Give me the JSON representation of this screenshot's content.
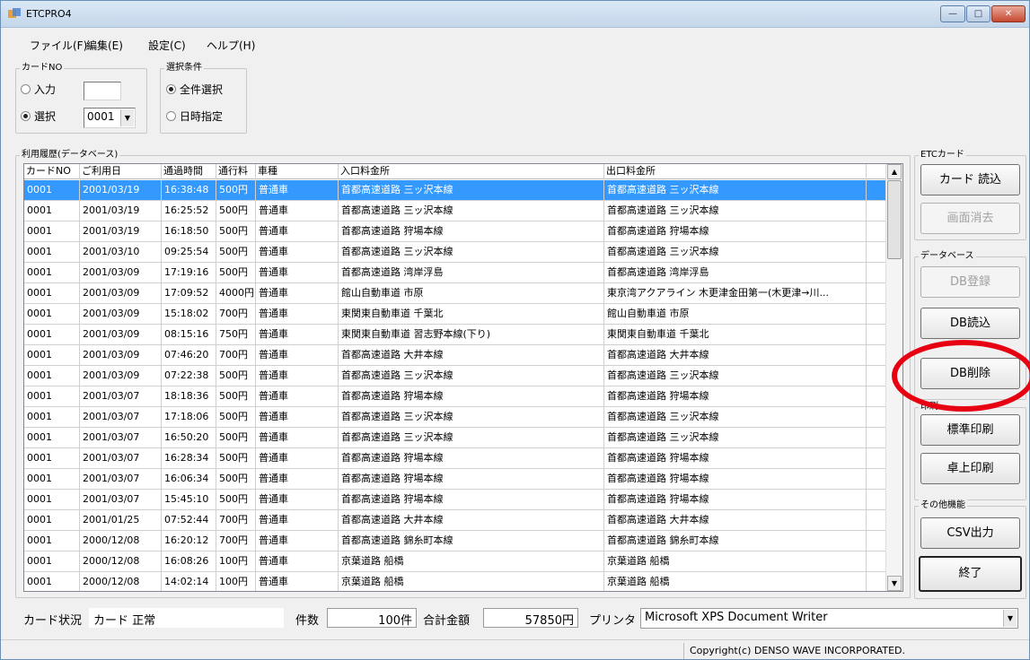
{
  "window": {
    "title": "ETCPRO4",
    "minimize": "—",
    "maximize": "□",
    "close": "✕"
  },
  "menu": [
    "ファイル(F)",
    "編集(E)",
    "設定(C)",
    "ヘルプ(H)"
  ],
  "card_no": {
    "legend": "カードNO",
    "input_label": "入力",
    "input_value": "",
    "select_label": "選択",
    "select_value": "0001",
    "selected": "選択"
  },
  "condition": {
    "legend": "選択条件",
    "all_label": "全件選択",
    "date_label": "日時指定",
    "selected": "全件選択"
  },
  "history": {
    "legend": "利用履歴(データベース)",
    "columns": [
      "カードNO",
      "ご利用日",
      "通過時間",
      "通行料金",
      "車種",
      "入口料金所",
      "出口料金所"
    ],
    "rows": [
      [
        "0001",
        "2001/03/19",
        "16:38:48",
        "500円",
        "普通車",
        "首都高速道路 三ッ沢本線",
        "首都高速道路 三ッ沢本線"
      ],
      [
        "0001",
        "2001/03/19",
        "16:25:52",
        "500円",
        "普通車",
        "首都高速道路 三ッ沢本線",
        "首都高速道路 三ッ沢本線"
      ],
      [
        "0001",
        "2001/03/19",
        "16:18:50",
        "500円",
        "普通車",
        "首都高速道路 狩場本線",
        "首都高速道路 狩場本線"
      ],
      [
        "0001",
        "2001/03/10",
        "09:25:54",
        "500円",
        "普通車",
        "首都高速道路 三ッ沢本線",
        "首都高速道路 三ッ沢本線"
      ],
      [
        "0001",
        "2001/03/09",
        "17:19:16",
        "500円",
        "普通車",
        "首都高速道路 湾岸浮島",
        "首都高速道路 湾岸浮島"
      ],
      [
        "0001",
        "2001/03/09",
        "17:09:52",
        "4000円",
        "普通車",
        "館山自動車道 市原",
        "東京湾アクアライン 木更津金田第一(木更津→川..."
      ],
      [
        "0001",
        "2001/03/09",
        "15:18:02",
        "700円",
        "普通車",
        "東関東自動車道 千葉北",
        "館山自動車道 市原"
      ],
      [
        "0001",
        "2001/03/09",
        "08:15:16",
        "750円",
        "普通車",
        "東関東自動車道 習志野本線(下り)",
        "東関東自動車道 千葉北"
      ],
      [
        "0001",
        "2001/03/09",
        "07:46:20",
        "700円",
        "普通車",
        "首都高速道路 大井本線",
        "首都高速道路 大井本線"
      ],
      [
        "0001",
        "2001/03/09",
        "07:22:38",
        "500円",
        "普通車",
        "首都高速道路 三ッ沢本線",
        "首都高速道路 三ッ沢本線"
      ],
      [
        "0001",
        "2001/03/07",
        "18:18:36",
        "500円",
        "普通車",
        "首都高速道路 狩場本線",
        "首都高速道路 狩場本線"
      ],
      [
        "0001",
        "2001/03/07",
        "17:18:06",
        "500円",
        "普通車",
        "首都高速道路 三ッ沢本線",
        "首都高速道路 三ッ沢本線"
      ],
      [
        "0001",
        "2001/03/07",
        "16:50:20",
        "500円",
        "普通車",
        "首都高速道路 三ッ沢本線",
        "首都高速道路 三ッ沢本線"
      ],
      [
        "0001",
        "2001/03/07",
        "16:28:34",
        "500円",
        "普通車",
        "首都高速道路 狩場本線",
        "首都高速道路 狩場本線"
      ],
      [
        "0001",
        "2001/03/07",
        "16:06:34",
        "500円",
        "普通車",
        "首都高速道路 狩場本線",
        "首都高速道路 狩場本線"
      ],
      [
        "0001",
        "2001/03/07",
        "15:45:10",
        "500円",
        "普通車",
        "首都高速道路 狩場本線",
        "首都高速道路 狩場本線"
      ],
      [
        "0001",
        "2001/01/25",
        "07:52:44",
        "700円",
        "普通車",
        "首都高速道路 大井本線",
        "首都高速道路 大井本線"
      ],
      [
        "0001",
        "2000/12/08",
        "16:20:12",
        "700円",
        "普通車",
        "首都高速道路 錦糸町本線",
        "首都高速道路 錦糸町本線"
      ],
      [
        "0001",
        "2000/12/08",
        "16:08:26",
        "100円",
        "普通車",
        "京葉道路 船橋",
        "京葉道路 船橋"
      ],
      [
        "0001",
        "2000/12/08",
        "14:02:14",
        "100円",
        "普通車",
        "京葉道路 船橋",
        "京葉道路 船橋"
      ]
    ]
  },
  "etc_card": {
    "legend": "ETCカード",
    "read": "カード 読込",
    "clear": "画面消去"
  },
  "database": {
    "legend": "データベース",
    "register": "DB登録",
    "load": "DB読込",
    "delete": "DB削除"
  },
  "print": {
    "legend": "印刷",
    "standard": "標準印刷",
    "desktop": "卓上印刷"
  },
  "other": {
    "legend": "その他機能",
    "csv": "CSV出力",
    "exit": "終了"
  },
  "status": {
    "card_label": "カード状況",
    "card_value": "カード 正常",
    "count_label": "件数",
    "count_value": "100件",
    "total_label": "合計金額",
    "total_value": "57850円",
    "printer_label": "プリンタ",
    "printer_value": "Microsoft XPS Document Writer"
  },
  "copyright": "Copyright(c) DENSO WAVE INCORPORATED.",
  "colors": {
    "selection": "#3399ff",
    "highlight_ring": "#e60012"
  }
}
